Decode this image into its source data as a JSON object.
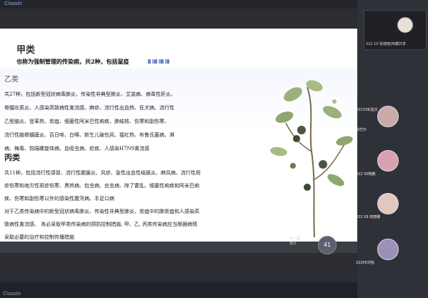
{
  "app": {
    "brand": "ClassIn"
  },
  "slide": {
    "jia_title": "甲类",
    "jia_line": "也称为强制管理的传染病，共2种，包括鼠疫",
    "yi_title": "乙类",
    "yi_lines": [
      "共27种，包括新型冠状病毒肺炎、传染性非典型肺炎、艾滋病、病毒性肝炎、",
      "脊髓灰质炎、人感染高致病性禽流感、麻疹、流行性出血热、狂犬病、流行性",
      "乙型脑炎、登革热、炭疽、细菌性阿米巴性痢疾、肺结核、伤寒和副伤寒、",
      "流行性脑脊髓膜炎、百日咳、白喉、新生儿破伤风、猩红热、布鲁氏菌病、淋",
      "病、梅毒、钩端螺旋体病、血吸虫病、疟疾、人感染H7N9禽流感"
    ],
    "bing_title": "丙类",
    "bing_lines": [
      "共11种，包括流行性感冒、流行性腮腺炎、风疹、急性出血性结膜炎、麻风病、流行性斑",
      "疹伤寒和地方性斑疹伤寒、黑热病、包虫病、丝虫病、除了霍乱、细菌性痢疾和阿米巴痢",
      "疾、伤寒和副伤寒以外的感染性腹泻病、手足口病",
      "对于乙类传染病中的新型冠状病毒肺炎、传染性非典型肺炎、炭疽中的肺炭疽和人感染高",
      "致病性禽流感、 务必采取甲类传染病的预防控制措施, 甲、乙, 丙类传染病应当根据病情",
      "采取必要的治疗和控制传播措施"
    ]
  },
  "page_control": {
    "label1": "下一页",
    "label2": "放大",
    "page_number": "41"
  },
  "panel": {
    "host_name": "222 10 张丽丽(阿藏共享",
    "participants": [
      {
        "name": "22233实验文"
      },
      {
        "name": "鼎艺玲"
      },
      {
        "name": "222 50杨鹏"
      },
      {
        "name": "222 09 高丽娜"
      },
      {
        "name": "22205刘怡"
      }
    ]
  },
  "colors": {
    "accent": "#5a6070",
    "background": "#2b2d33"
  }
}
